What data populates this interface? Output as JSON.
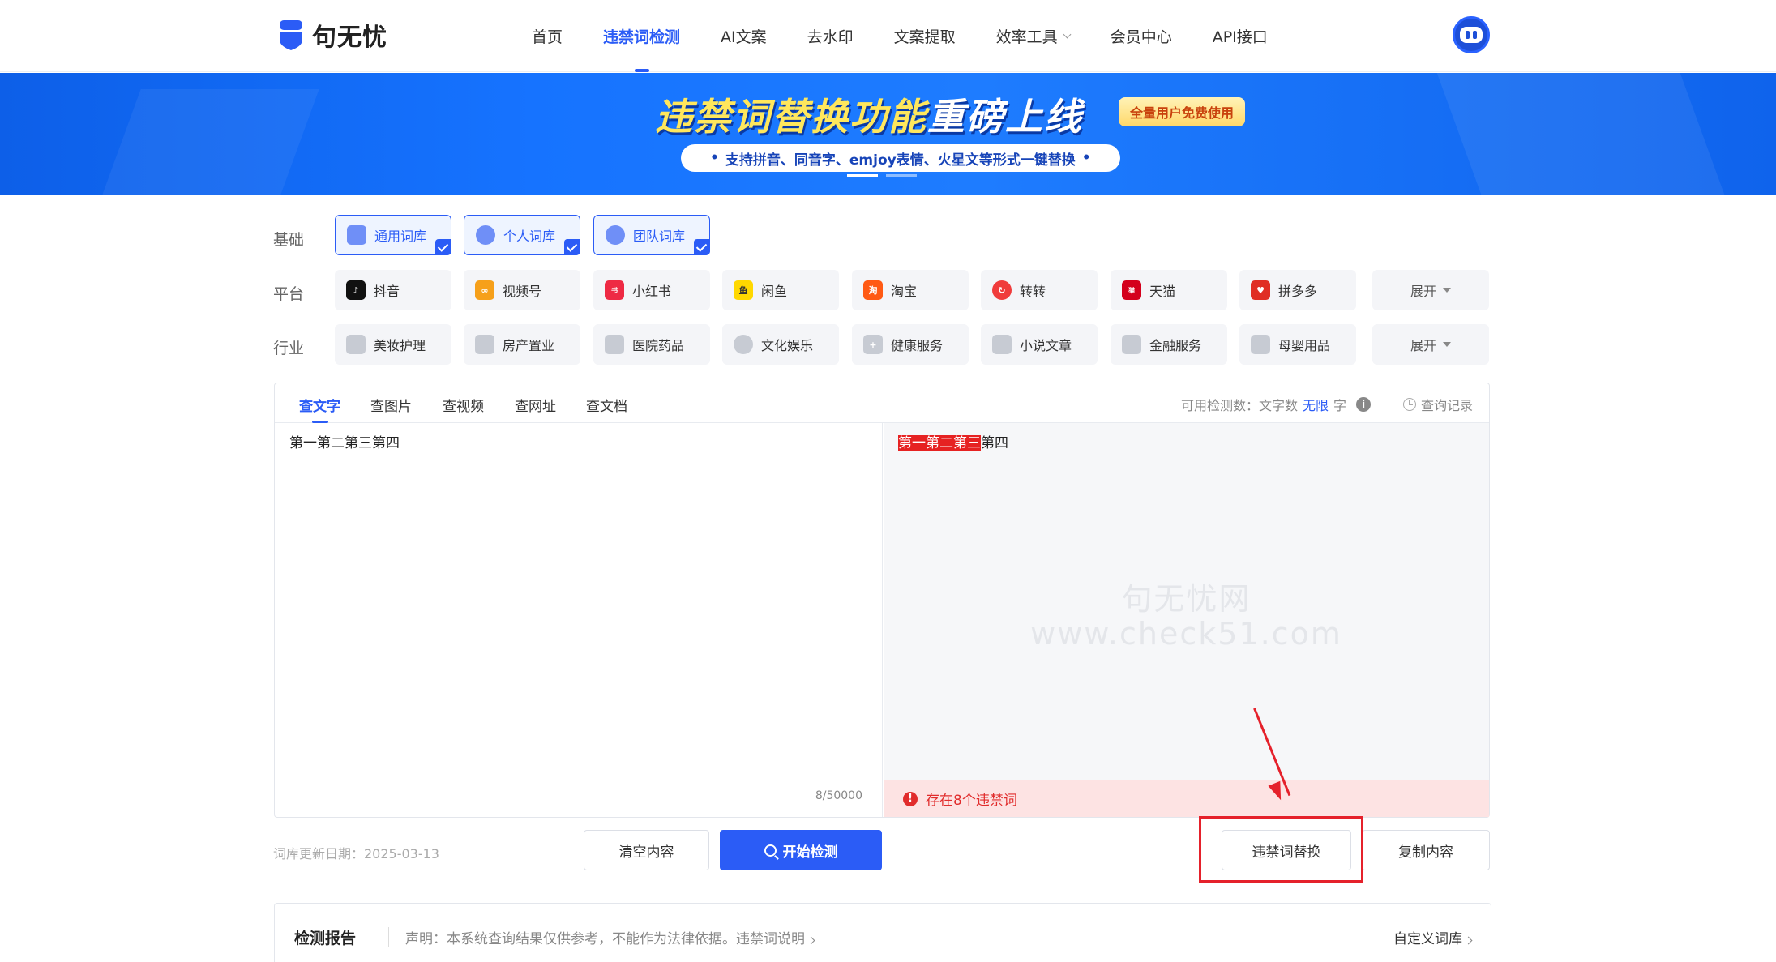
{
  "header": {
    "logo_text": "句无忧",
    "nav": [
      "首页",
      "违禁词检测",
      "AI文案",
      "去水印",
      "文案提取",
      "效率工具",
      "会员中心",
      "API接口"
    ],
    "active_nav": "违禁词检测"
  },
  "banner": {
    "title_a": "违禁词替换功能",
    "title_b": "重磅上线",
    "badge": "全量用户免费使用",
    "subtitle": "支持拼音、同音字、emjoy表情、火星文等形式一键替换"
  },
  "filters": {
    "base_label": "基础",
    "base": [
      "通用词库",
      "个人词库",
      "团队词库"
    ],
    "platform_label": "平台",
    "platforms": [
      "抖音",
      "视频号",
      "小红书",
      "闲鱼",
      "淘宝",
      "转转",
      "天猫",
      "拼多多"
    ],
    "industry_label": "行业",
    "industries": [
      "美妆护理",
      "房产置业",
      "医院药品",
      "文化娱乐",
      "健康服务",
      "小说文章",
      "金融服务",
      "母婴用品"
    ],
    "expand": "展开"
  },
  "tabs": [
    "查文字",
    "查图片",
    "查视频",
    "查网址",
    "查文档"
  ],
  "quota": {
    "prefix": "可用检测数：文字数",
    "value": "无限",
    "unit": "字"
  },
  "history": "查询记录",
  "input": {
    "text": "第一第二第三第四",
    "count": "8/50000"
  },
  "result": {
    "highlighted": "第一第二第三",
    "rest": "第四",
    "watermark_line1": "句无忧网",
    "watermark_line2": "www.check51.com",
    "warning": "存在8个违禁词"
  },
  "actions": {
    "update_date": "词库更新日期：2025-03-13",
    "clear": "清空内容",
    "start": "开始检测",
    "replace": "违禁词替换",
    "copy": "复制内容"
  },
  "report": {
    "title": "检测报告",
    "note": "声明：本系统查询结果仅供参考，不能作为法律依据。违禁词说明",
    "custom": "自定义词库"
  },
  "colors": {
    "accent": "#2b5cf6",
    "danger": "#e12c2c"
  }
}
